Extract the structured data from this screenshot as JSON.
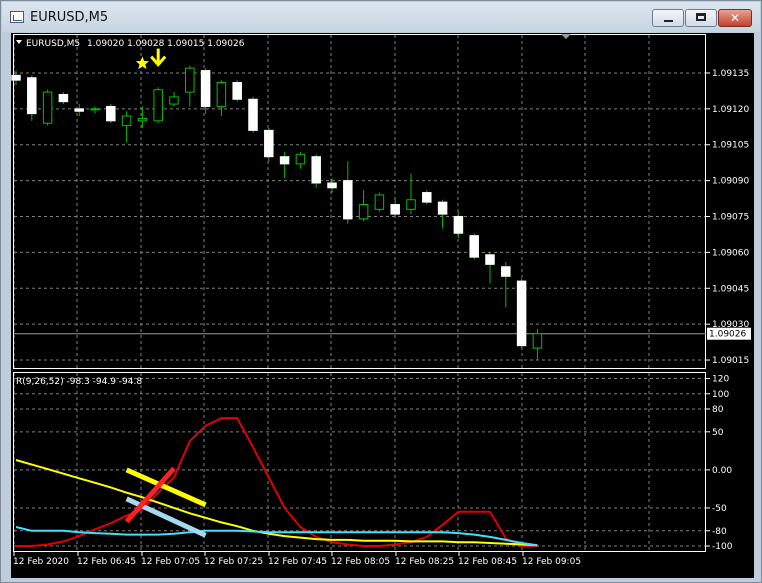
{
  "window": {
    "title": "EURUSD,M5",
    "close_label": "✕"
  },
  "chart_header": {
    "symbol": "EURUSD,M5",
    "ohlc": "1.09020 1.09028 1.09015 1.09026"
  },
  "indicator_header": {
    "label": "R(9,26,52) -98.3 -94.9 -94.8"
  },
  "colors": {
    "background": "#000000",
    "grid": "#7f7f7f",
    "bull_candle": "#ffffff",
    "bear_candle": "#ffffff",
    "wick": "#00c000",
    "line_red": "#e00000",
    "line_yellow": "#ffff00",
    "line_cyan": "#40e0ff",
    "marker_arrow": "#ffff00",
    "marker_star": "#ffff00"
  },
  "chart_data": [
    {
      "type": "candlestick",
      "title": "EURUSD,M5",
      "price_axis": {
        "ticks": [
          "1.09135",
          "1.09120",
          "1.09105",
          "1.09090",
          "1.09075",
          "1.09060",
          "1.09045",
          "1.09030",
          "1.09015"
        ],
        "current_price_label": "1.09026",
        "ylim": [
          1.0901,
          1.0915
        ]
      },
      "x_axis_labels": [
        "12 Feb 2020",
        "12 Feb 06:45",
        "12 Feb 07:05",
        "12 Feb 07:25",
        "12 Feb 07:45",
        "12 Feb 08:05",
        "12 Feb 08:25",
        "12 Feb 08:45",
        "12 Feb 09:05"
      ],
      "candles": [
        {
          "o": 1.09134,
          "h": 1.09136,
          "l": 1.0913,
          "c": 1.09132
        },
        {
          "o": 1.09133,
          "h": 1.09134,
          "l": 1.09115,
          "c": 1.09118
        },
        {
          "o": 1.09114,
          "h": 1.09128,
          "l": 1.09113,
          "c": 1.09127
        },
        {
          "o": 1.09126,
          "h": 1.09127,
          "l": 1.09122,
          "c": 1.09123
        },
        {
          "o": 1.0912,
          "h": 1.09122,
          "l": 1.09117,
          "c": 1.09119
        },
        {
          "o": 1.0912,
          "h": 1.09121,
          "l": 1.09118,
          "c": 1.0912
        },
        {
          "o": 1.09121,
          "h": 1.09122,
          "l": 1.09114,
          "c": 1.09115
        },
        {
          "o": 1.09113,
          "h": 1.09119,
          "l": 1.09106,
          "c": 1.09117
        },
        {
          "o": 1.09115,
          "h": 1.09121,
          "l": 1.09112,
          "c": 1.09116
        },
        {
          "o": 1.09115,
          "h": 1.09129,
          "l": 1.09114,
          "c": 1.09128
        },
        {
          "o": 1.09122,
          "h": 1.09127,
          "l": 1.09121,
          "c": 1.09125
        },
        {
          "o": 1.09127,
          "h": 1.09138,
          "l": 1.09121,
          "c": 1.09137
        },
        {
          "o": 1.09136,
          "h": 1.09137,
          "l": 1.09118,
          "c": 1.09121
        },
        {
          "o": 1.09121,
          "h": 1.09132,
          "l": 1.09117,
          "c": 1.09131
        },
        {
          "o": 1.09131,
          "h": 1.09132,
          "l": 1.09123,
          "c": 1.09124
        },
        {
          "o": 1.09124,
          "h": 1.09125,
          "l": 1.0911,
          "c": 1.09111
        },
        {
          "o": 1.09111,
          "h": 1.09112,
          "l": 1.09098,
          "c": 1.091
        },
        {
          "o": 1.091,
          "h": 1.09102,
          "l": 1.09091,
          "c": 1.09097
        },
        {
          "o": 1.09097,
          "h": 1.09102,
          "l": 1.09095,
          "c": 1.09101
        },
        {
          "o": 1.091,
          "h": 1.09101,
          "l": 1.09087,
          "c": 1.09089
        },
        {
          "o": 1.09089,
          "h": 1.09091,
          "l": 1.09085,
          "c": 1.09087
        },
        {
          "o": 1.0909,
          "h": 1.09098,
          "l": 1.09072,
          "c": 1.09074
        },
        {
          "o": 1.09074,
          "h": 1.09086,
          "l": 1.09073,
          "c": 1.0908
        },
        {
          "o": 1.09078,
          "h": 1.09085,
          "l": 1.09077,
          "c": 1.09084
        },
        {
          "o": 1.0908,
          "h": 1.09083,
          "l": 1.09075,
          "c": 1.09076
        },
        {
          "o": 1.09078,
          "h": 1.09093,
          "l": 1.09076,
          "c": 1.09082
        },
        {
          "o": 1.09085,
          "h": 1.09086,
          "l": 1.0908,
          "c": 1.09081
        },
        {
          "o": 1.09081,
          "h": 1.09082,
          "l": 1.0907,
          "c": 1.09076
        },
        {
          "o": 1.09075,
          "h": 1.09077,
          "l": 1.09066,
          "c": 1.09068
        },
        {
          "o": 1.09067,
          "h": 1.09068,
          "l": 1.09057,
          "c": 1.09058
        },
        {
          "o": 1.09059,
          "h": 1.0906,
          "l": 1.09047,
          "c": 1.09055
        },
        {
          "o": 1.09054,
          "h": 1.09056,
          "l": 1.09037,
          "c": 1.0905
        },
        {
          "o": 1.09048,
          "h": 1.09049,
          "l": 1.0902,
          "c": 1.09021
        },
        {
          "o": 1.0902,
          "h": 1.09028,
          "l": 1.09015,
          "c": 1.09026
        }
      ],
      "markers": [
        {
          "type": "star",
          "bar": 8,
          "price": 1.09139
        },
        {
          "type": "arrow-down",
          "bar": 9,
          "price": 1.09141
        }
      ]
    },
    {
      "type": "line",
      "title": "R(9,26,52) -98.3 -94.9 -94.8",
      "y_axis": {
        "ticks": [
          "120",
          "100",
          "80",
          "50",
          "0.00",
          "-50",
          "-80",
          "-100"
        ],
        "ylim": [
          -105,
          125
        ]
      },
      "series": [
        {
          "values": [
            -100,
            -100,
            -98,
            -94,
            -87,
            -78,
            -70,
            -60,
            -52,
            -30,
            -10,
            38,
            58,
            68,
            68,
            30,
            -10,
            -50,
            -75,
            -88,
            -95,
            -98,
            -100,
            -100,
            -98,
            -95,
            -88,
            -72,
            -55,
            -55,
            -55,
            -90,
            -100,
            -100
          ]
        },
        {
          "values": [
            13,
            7,
            1,
            -5,
            -11,
            -17,
            -23,
            -30,
            -36,
            -43,
            -50,
            -57,
            -63,
            -69,
            -74,
            -80,
            -84,
            -87,
            -89,
            -91,
            -92,
            -92,
            -93,
            -93,
            -93,
            -94,
            -94,
            -94,
            -95,
            -95,
            -96,
            -97,
            -98,
            -99
          ]
        },
        {
          "values": [
            -75,
            -80,
            -80,
            -80,
            -82,
            -83,
            -84,
            -85,
            -85,
            -85,
            -84,
            -82,
            -80,
            -80,
            -80,
            -81,
            -82,
            -82,
            -82,
            -82,
            -82,
            -82,
            -82,
            -82,
            -82,
            -82,
            -82,
            -82,
            -83,
            -85,
            -88,
            -92,
            -96,
            -99
          ]
        }
      ],
      "trend_segments": [
        {
          "color": "yellow",
          "from": {
            "bar": 7,
            "value": 0
          },
          "to": {
            "bar": 12,
            "value": -46
          }
        },
        {
          "color": "lightblue",
          "from": {
            "bar": 7,
            "value": -38
          },
          "to": {
            "bar": 12,
            "value": -86
          }
        },
        {
          "color": "red",
          "from": {
            "bar": 7,
            "value": -68
          },
          "to": {
            "bar": 10,
            "value": 2
          }
        }
      ]
    }
  ]
}
